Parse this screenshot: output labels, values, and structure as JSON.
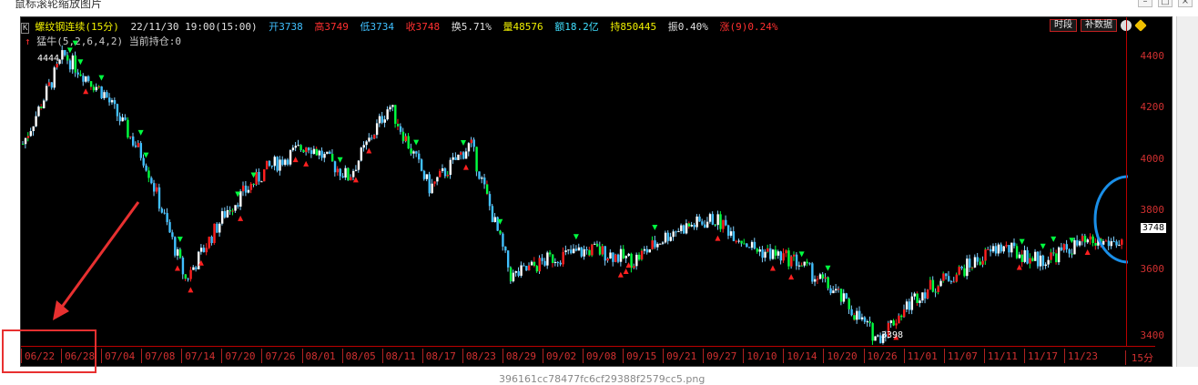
{
  "window": {
    "title": "鼠标滚轮缩放图片"
  },
  "header": {
    "box": "K",
    "name": "螺纹钢连续(15分)",
    "datetime": "22/11/30 19:00(15:00)",
    "open": "开3738",
    "high": "高3749",
    "low": "低3734",
    "close": "收3748",
    "turnover": "换5.71%",
    "volume": "量48576",
    "amount": "额18.2亿",
    "position": "持850445",
    "amplitude": "振0.40%",
    "change": "涨(9)0.24%"
  },
  "indicator": {
    "label": "猛牛(5,2,6,4,2)",
    "holding": "当前持仓:0"
  },
  "buttons": {
    "period": "时段",
    "supplement": "补数据"
  },
  "yaxis": {
    "labels": [
      "4400",
      "4200",
      "4000",
      "3800",
      "3600",
      "3400"
    ],
    "current": "3748"
  },
  "dates": [
    "06/22",
    "06/28",
    "07/04",
    "07/08",
    "07/14",
    "07/20",
    "07/26",
    "08/01",
    "08/05",
    "08/11",
    "08/17",
    "08/23",
    "08/29",
    "09/02",
    "09/08",
    "09/15",
    "09/21",
    "09/27",
    "10/10",
    "10/14",
    "10/20",
    "10/26",
    "11/01",
    "11/07",
    "11/11",
    "11/17",
    "11/23"
  ],
  "period": "15分",
  "annotations": {
    "low_marker": "3398",
    "high_marker": "4444"
  },
  "colors": {
    "up": "#ff2020",
    "down": "#00ff40",
    "neutral": "#7fd0ff",
    "text_red": "#ff3030",
    "accent_blue": "#1a8fe8",
    "annot_red": "#e83030"
  },
  "caption": "396161cc78477fc6cf29388f2579cc5.png",
  "chart_data": {
    "type": "line",
    "title": "螺纹钢连续(15分)",
    "xlabel": "",
    "ylabel": "",
    "ylim": [
      3370,
      4490
    ],
    "categories": [
      "06/22",
      "06/28",
      "07/04",
      "07/08",
      "07/14",
      "07/20",
      "07/26",
      "08/01",
      "08/05",
      "08/11",
      "08/17",
      "08/23",
      "08/29",
      "09/02",
      "09/08",
      "09/15",
      "09/21",
      "09/27",
      "10/10",
      "10/14",
      "10/20",
      "10/26",
      "11/01",
      "11/07",
      "11/11",
      "11/17",
      "11/23",
      "11/30"
    ],
    "series": [
      {
        "values": [
          4100,
          4420,
          4280,
          4040,
          3610,
          3860,
          4010,
          4100,
          3980,
          4240,
          3940,
          4100,
          3620,
          3690,
          3720,
          3680,
          3790,
          3830,
          3720,
          3680,
          3560,
          3400,
          3560,
          3640,
          3730,
          3680,
          3740,
          3748
        ]
      }
    ]
  }
}
